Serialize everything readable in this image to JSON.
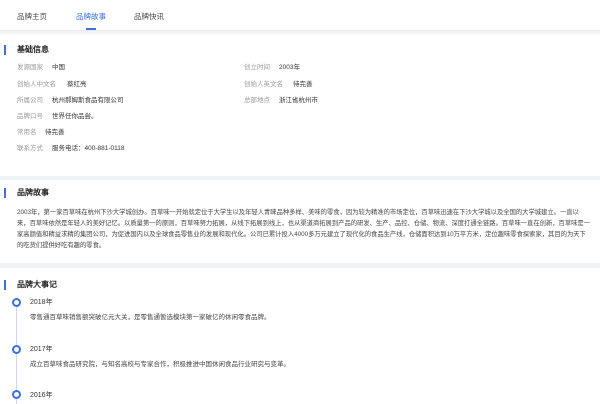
{
  "tabs": [
    {
      "label": "品牌主页"
    },
    {
      "label": "品牌故事"
    },
    {
      "label": "品牌快讯"
    }
  ],
  "basic": {
    "title": "基础信息",
    "origin": {
      "label": "发源国家",
      "value": "中国"
    },
    "founded": {
      "label": "创立时间",
      "value": "2003年"
    },
    "founder_cn": {
      "label": "创始人中文名",
      "value": "蔡红亮"
    },
    "founder_en": {
      "label": "创始人英文名",
      "value": "待完善"
    },
    "company": {
      "label": "所属公司",
      "value": "杭州郝姆斯食品有限公司"
    },
    "hq": {
      "label": "总部地点",
      "value": "浙江省杭州市"
    },
    "slogan": {
      "label": "品牌口号",
      "value": "世界任你品尝。"
    },
    "alias": {
      "label": "常用名",
      "value": "待完善"
    },
    "contact": {
      "label": "联系方式",
      "value": "服务电话：400-881-0118"
    }
  },
  "story": {
    "title": "品牌故事",
    "text": "2003年，第一家百草味在杭州下沙大学城创办。百草味一开始就定位于大学生以及年轻人青睐品种多样、美味的零食，因为较为精准的市场定位，百草味迅速在下沙大学城以及全国的大学城建立。一直以来，百草味依然是年轻人的美好记忆。以质量第一的原则，百草味努力拓展，从线下拓展到线上，也从渠道商拓展到产品的研发、生产、品控、仓储、物流、深度打通全链路。百草味一直在创新，百草味是一家高颜值和精益求精的集团公司，为促进国内以及全球食品零售业的发展和现代化。公司已累计投入4000多万元建立了现代化的食品生产线，仓储面积达到10万平方米，定位趣味零食探索家，其目的为天下的吃货们提供好吃有趣的零食。"
  },
  "events": {
    "title": "品牌大事记",
    "items": [
      {
        "year": "2018年",
        "text": "零售通百草味销售额突破亿元大关，是零售通暂选模块第一家破亿的休闲零食品牌。"
      },
      {
        "year": "2017年",
        "text": "成立百草味食品研究院，与知名高校与专家合作，积极推进中国休闲食品行业研究与变革。"
      },
      {
        "year": "2016年",
        "text": ""
      }
    ]
  },
  "colors": {
    "accent": "#3b6fe0",
    "background": "#f2f3f5"
  }
}
